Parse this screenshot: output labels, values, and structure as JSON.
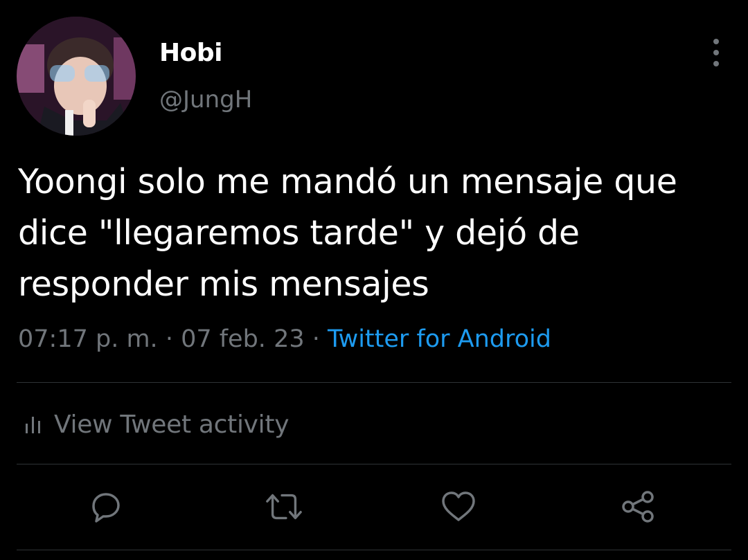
{
  "author": {
    "display_name": "Hobi",
    "handle": "@JungH",
    "avatar_icon": "profile-photo"
  },
  "tweet": {
    "text": "Yoongi solo me mandó un mensaje que dice \"llegaremos tarde\" y dejó de responder mis mensajes",
    "time": "07:17 p. m.",
    "separator": " · ",
    "date": "07 feb. 23",
    "source": "Twitter for Android"
  },
  "activity": {
    "label": "View Tweet activity",
    "icon": "bar-chart-icon"
  },
  "actions": [
    {
      "name": "reply",
      "icon": "comment-icon"
    },
    {
      "name": "retweet",
      "icon": "retweet-icon"
    },
    {
      "name": "like",
      "icon": "heart-icon"
    },
    {
      "name": "share",
      "icon": "share-icon"
    }
  ],
  "colors": {
    "background": "#000000",
    "primary_text": "#ffffff",
    "secondary_text": "#71767b",
    "link": "#1d9bf0",
    "divider": "#2f3336"
  }
}
